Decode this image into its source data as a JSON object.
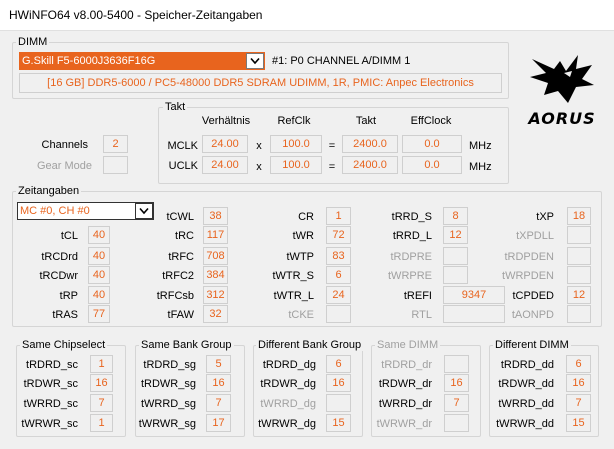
{
  "window": {
    "title": "HWiNFO64 v8.00-5400 - Speicher-Zeitangaben"
  },
  "dimm": {
    "group_label": "DIMM",
    "selected_module": "G.Skill F5-6000J3636F16G",
    "slot_label": "#1: P0 CHANNEL A/DIMM 1",
    "info": "[16 GB] DDR5-6000 / PC5-48000 DDR5 SDRAM UDIMM, 1R, PMIC: Anpec Electronics"
  },
  "channels": {
    "label": "Channels",
    "value": "2",
    "gear_label": "Gear Mode",
    "gear_value": ""
  },
  "takt": {
    "group_label": "Takt",
    "headers": {
      "ratio": "Verhältnis",
      "refclk": "RefClk",
      "takt": "Takt",
      "effclock": "EffClock"
    },
    "mclk": {
      "label": "MCLK",
      "ratio": "24.00",
      "op1": "x",
      "refclk": "100.0",
      "op2": "=",
      "takt": "2400.0",
      "eff": "0.0",
      "unit": "MHz"
    },
    "uclk": {
      "label": "UCLK",
      "ratio": "24.00",
      "op1": "x",
      "refclk": "100.0",
      "op2": "=",
      "takt": "2400.0",
      "eff": "0.0",
      "unit": "MHz"
    }
  },
  "logo": {
    "text": "AORUS"
  },
  "timings": {
    "group_label": "Zeitangaben",
    "selector": "MC #0, CH #0",
    "col1": [
      {
        "label": "tCL",
        "value": "40"
      },
      {
        "label": "tRCDrd",
        "value": "40"
      },
      {
        "label": "tRCDwr",
        "value": "40"
      },
      {
        "label": "tRP",
        "value": "40"
      },
      {
        "label": "tRAS",
        "value": "77"
      }
    ],
    "col2": [
      {
        "label": "tCWL",
        "value": "38"
      },
      {
        "label": "tRC",
        "value": "117"
      },
      {
        "label": "tRFC",
        "value": "708"
      },
      {
        "label": "tRFC2",
        "value": "384"
      },
      {
        "label": "tRFCsb",
        "value": "312"
      },
      {
        "label": "tFAW",
        "value": "32"
      }
    ],
    "col3": [
      {
        "label": "CR",
        "value": "1"
      },
      {
        "label": "tWR",
        "value": "72"
      },
      {
        "label": "tWTP",
        "value": "83"
      },
      {
        "label": "tWTR_S",
        "value": "6"
      },
      {
        "label": "tWTR_L",
        "value": "24"
      },
      {
        "label": "tCKE",
        "value": ""
      }
    ],
    "col4": [
      {
        "label": "tRRD_S",
        "value": "8"
      },
      {
        "label": "tRRD_L",
        "value": "12"
      },
      {
        "label": "tRDPRE",
        "value": ""
      },
      {
        "label": "tWRPRE",
        "value": ""
      },
      {
        "label": "tREFI",
        "value": "9347"
      },
      {
        "label": "RTL",
        "value": ""
      }
    ],
    "col5": [
      {
        "label": "tXP",
        "value": "18"
      },
      {
        "label": "tXPDLL",
        "value": ""
      },
      {
        "label": "tRDPDEN",
        "value": ""
      },
      {
        "label": "tWRPDEN",
        "value": ""
      },
      {
        "label": "tCPDED",
        "value": "12"
      },
      {
        "label": "tAONPD",
        "value": ""
      }
    ]
  },
  "bottom": {
    "same_chipselect": {
      "label": "Same Chipselect",
      "rows": [
        {
          "label": "tRDRD_sc",
          "value": "1"
        },
        {
          "label": "tRDWR_sc",
          "value": "16"
        },
        {
          "label": "tWRRD_sc",
          "value": "7"
        },
        {
          "label": "tWRWR_sc",
          "value": "1"
        }
      ]
    },
    "same_bank_group": {
      "label": "Same Bank Group",
      "rows": [
        {
          "label": "tRDRD_sg",
          "value": "5"
        },
        {
          "label": "tRDWR_sg",
          "value": "16"
        },
        {
          "label": "tWRRD_sg",
          "value": "7"
        },
        {
          "label": "tWRWR_sg",
          "value": "17"
        }
      ]
    },
    "different_bank_group": {
      "label": "Different Bank Group",
      "rows": [
        {
          "label": "tRDRD_dg",
          "value": "6"
        },
        {
          "label": "tRDWR_dg",
          "value": "16"
        },
        {
          "label": "tWRRD_dg",
          "value": ""
        },
        {
          "label": "tWRWR_dg",
          "value": "15"
        }
      ]
    },
    "same_dimm": {
      "label": "Same DIMM",
      "rows": [
        {
          "label": "tRDRD_dr",
          "value": ""
        },
        {
          "label": "tRDWR_dr",
          "value": "16"
        },
        {
          "label": "tWRRD_dr",
          "value": "7"
        },
        {
          "label": "tWRWR_dr",
          "value": ""
        }
      ]
    },
    "different_dimm": {
      "label": "Different DIMM",
      "rows": [
        {
          "label": "tRDRD_dd",
          "value": "6"
        },
        {
          "label": "tRDWR_dd",
          "value": "16"
        },
        {
          "label": "tWRRD_dd",
          "value": "7"
        },
        {
          "label": "tWRWR_dd",
          "value": "15"
        }
      ]
    }
  },
  "colors": {
    "accent": "#e8641e",
    "background": "#f0f0f0",
    "disabled_text": "#a0a0a0"
  }
}
